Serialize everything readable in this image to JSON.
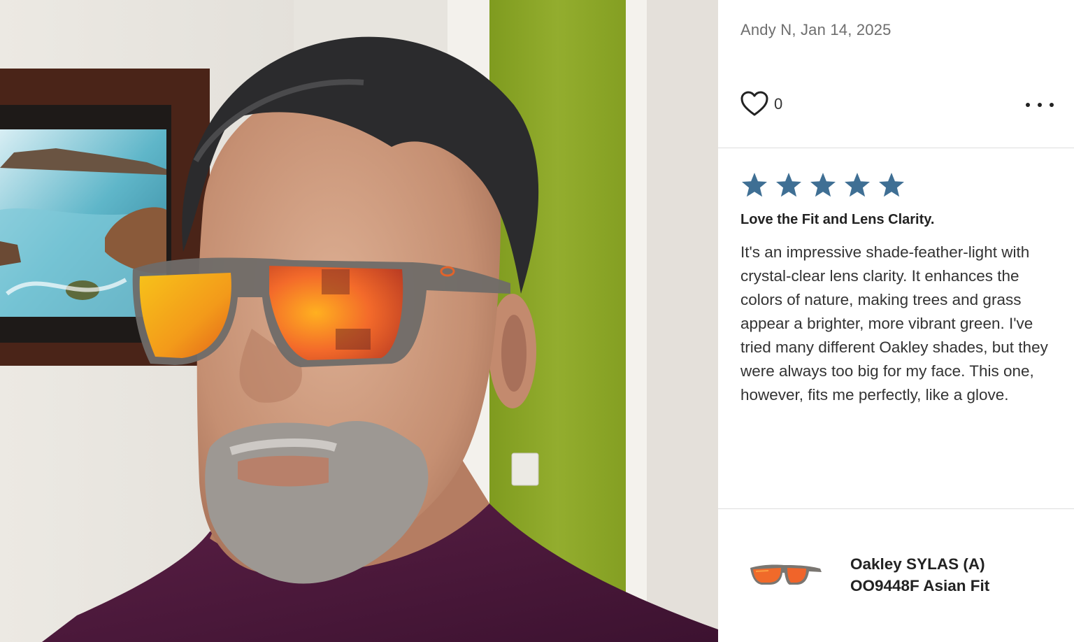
{
  "review": {
    "author_date": "Andy N, Jan 14, 2025",
    "like_count": "0",
    "rating": 5,
    "title": "Love the Fit and Lens Clarity.",
    "body": "It's an impressive shade-feather-light with crystal-clear lens clarity. It enhances the colors of nature, making trees and grass appear a brighter, more vibrant green. I've tried many different Oakley shades, but they were always too big for my face. This one, however, fits me perfectly, like a glove."
  },
  "product": {
    "name_line1": "Oakley SYLAS (A)",
    "name_line2": "OO9448F Asian Fit"
  },
  "icons": {
    "like": "heart-outline-icon",
    "menu": "more-horizontal-icon",
    "rating": "star-filled-icon"
  },
  "colors": {
    "star": "#3f6f94",
    "author_text": "#6e6e6e",
    "divider": "#dedede",
    "wall_green": "#8ea82a",
    "lens_orange": "#f0642a",
    "shirt": "#4a1838"
  }
}
